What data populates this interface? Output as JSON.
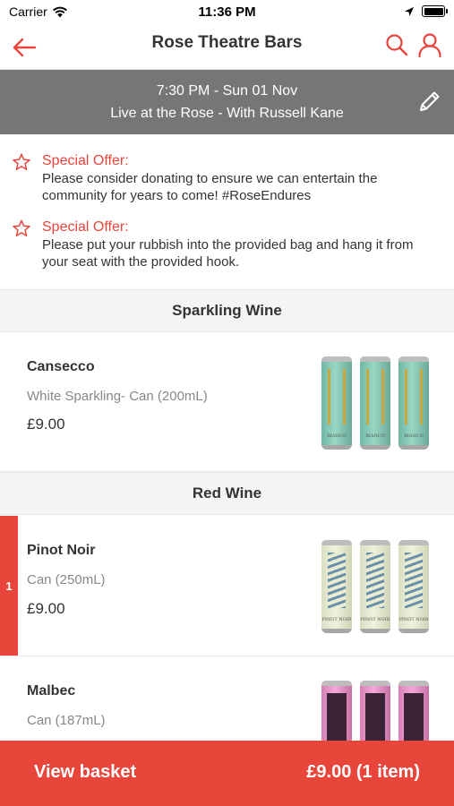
{
  "status_bar": {
    "carrier": "Carrier",
    "time": "11:36 PM"
  },
  "nav": {
    "title": "Rose Theatre Bars"
  },
  "event": {
    "datetime": "7:30 PM - Sun 01 Nov",
    "name": "Live at the Rose - With Russell Kane"
  },
  "offers": [
    {
      "title": "Special Offer:",
      "text": "Please consider donating to ensure we can entertain the community for years to come! #RoseEndures"
    },
    {
      "title": "Special Offer:",
      "text": "Please put your rubbish into the provided bag and hang it from your seat with the provided hook."
    }
  ],
  "sections": [
    {
      "title": "Sparkling Wine",
      "products": [
        {
          "name": "Cansecco",
          "description": "White Sparkling- Can (200mL)",
          "price": "£9.00",
          "image_style": "green",
          "can_label": "BIANCO"
        }
      ]
    },
    {
      "title": "Red Wine",
      "products": [
        {
          "name": "Pinot Noir",
          "description": "Can (250mL)",
          "price": "£9.00",
          "quantity": "1",
          "image_style": "pale",
          "can_label": "PINOT NOIR"
        },
        {
          "name": "Malbec",
          "description": "Can (187mL)",
          "price": "",
          "image_style": "pink"
        }
      ]
    }
  ],
  "basket": {
    "label": "View basket",
    "total": "£9.00 (1 item)"
  },
  "colors": {
    "accent": "#e8453b",
    "event_bar": "#767676"
  }
}
